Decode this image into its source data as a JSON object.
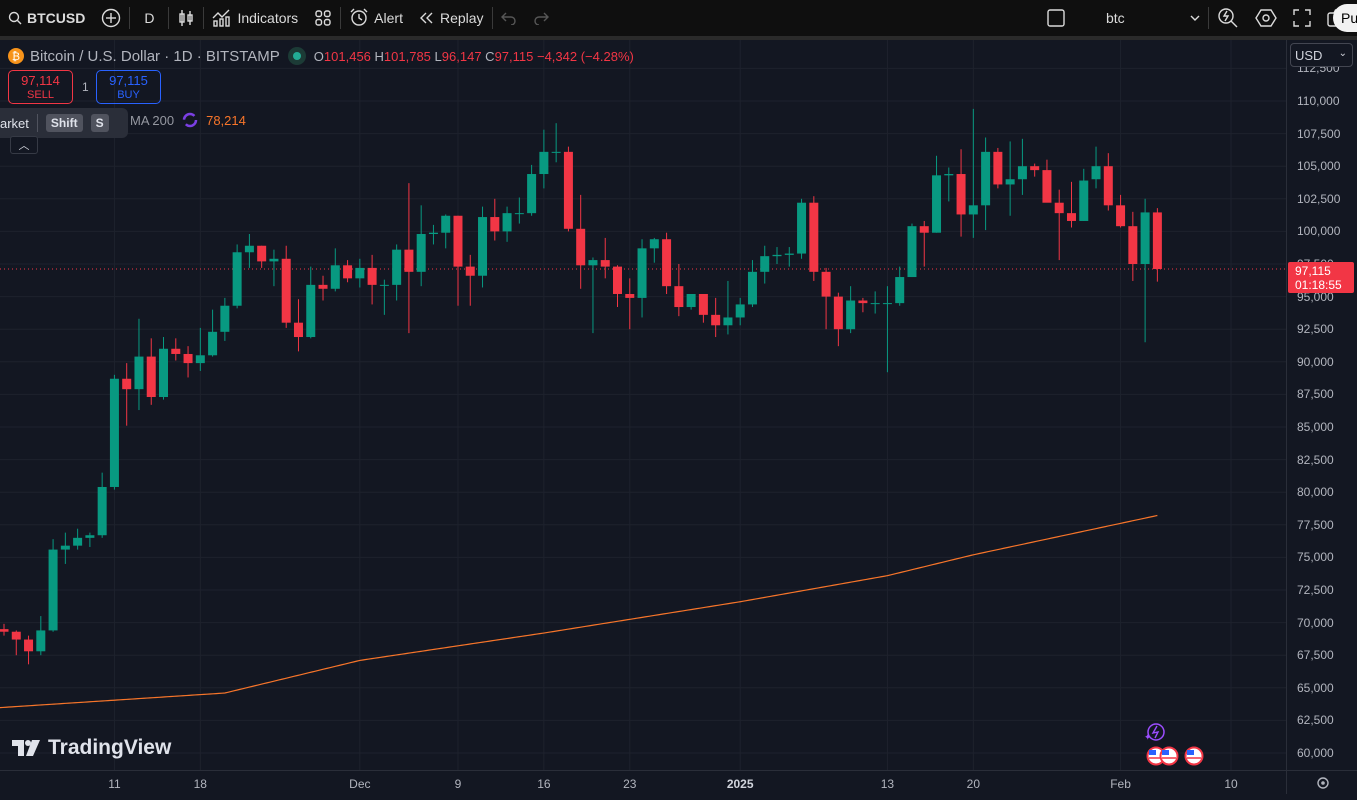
{
  "toolbar": {
    "symbol": "BTCUSD",
    "interval": "D",
    "indicators_label": "Indicators",
    "alert_label": "Alert",
    "replay_label": "Replay",
    "layout_name": "btc",
    "publish_label": "Pu"
  },
  "legend": {
    "title": "Bitcoin / U.S. Dollar · 1D · BITSTAMP",
    "o_label": "O",
    "o": "101,456",
    "h_label": "H",
    "h": "101,785",
    "l_label": "L",
    "l": "96,147",
    "c_label": "C",
    "c": "97,115",
    "change": "−4,342 (−4.28%)"
  },
  "trade": {
    "sell_price": "97,114",
    "sell_label": "SELL",
    "quantity": "1",
    "buy_price": "97,115",
    "buy_label": "BUY"
  },
  "tooltip": {
    "text": "arket",
    "key1": "Shift",
    "key2": "S"
  },
  "ma": {
    "label": "MA 200",
    "value": "78,214"
  },
  "currency": "USD",
  "price_tag": {
    "price": "97,115",
    "countdown": "01:18:55"
  },
  "brand": "TradingView",
  "colors": {
    "up": "#089981",
    "down": "#f23645",
    "ma": "#f7752a",
    "background": "#131722"
  },
  "chart_data": {
    "type": "candlestick",
    "symbol": "BTCUSD",
    "y_ticks": [
      "60,000",
      "62,500",
      "65,000",
      "67,500",
      "70,000",
      "72,500",
      "75,000",
      "77,500",
      "80,000",
      "82,500",
      "85,000",
      "87,500",
      "90,000",
      "92,500",
      "95,000",
      "97,500",
      "100,000",
      "102,500",
      "105,000",
      "107,500",
      "110,000",
      "112,500"
    ],
    "ylim": [
      60000,
      112500
    ],
    "x_ticks": [
      {
        "label": "11",
        "date": "2024-11-11"
      },
      {
        "label": "18",
        "date": "2024-11-18"
      },
      {
        "label": "Dec",
        "date": "2024-12-01"
      },
      {
        "label": "9",
        "date": "2024-12-09"
      },
      {
        "label": "16",
        "date": "2024-12-16"
      },
      {
        "label": "23",
        "date": "2024-12-23"
      },
      {
        "label": "2025",
        "date": "2025-01-01",
        "bold": true
      },
      {
        "label": "13",
        "date": "2025-01-13"
      },
      {
        "label": "20",
        "date": "2025-01-20"
      },
      {
        "label": "Feb",
        "date": "2025-02-01"
      },
      {
        "label": "10",
        "date": "2025-02-10"
      }
    ],
    "last_price": 97115,
    "candles_ohlc": [
      [
        "2024-11-02",
        69500,
        69900,
        69000,
        69300
      ],
      [
        "2024-11-03",
        69300,
        69400,
        67500,
        68700
      ],
      [
        "2024-11-04",
        68700,
        69000,
        66800,
        67800
      ],
      [
        "2024-11-05",
        67800,
        70500,
        67500,
        69400
      ],
      [
        "2024-11-06",
        69400,
        76400,
        69300,
        75600
      ],
      [
        "2024-11-07",
        75600,
        76900,
        74500,
        75900
      ],
      [
        "2024-11-08",
        75900,
        77200,
        75600,
        76500
      ],
      [
        "2024-11-09",
        76500,
        76900,
        75800,
        76700
      ],
      [
        "2024-11-10",
        76700,
        81500,
        76500,
        80400
      ],
      [
        "2024-11-11",
        80400,
        89000,
        80200,
        88700
      ],
      [
        "2024-11-12",
        88700,
        89900,
        85100,
        87900
      ],
      [
        "2024-11-13",
        87900,
        93300,
        86300,
        90400
      ],
      [
        "2024-11-14",
        90400,
        91800,
        86700,
        87300
      ],
      [
        "2024-11-15",
        87300,
        91900,
        87100,
        91000
      ],
      [
        "2024-11-16",
        91000,
        91800,
        90100,
        90600
      ],
      [
        "2024-11-17",
        90600,
        91200,
        88800,
        89900
      ],
      [
        "2024-11-18",
        89900,
        92600,
        89300,
        90500
      ],
      [
        "2024-11-19",
        90500,
        94000,
        90400,
        92300
      ],
      [
        "2024-11-20",
        92300,
        94900,
        91600,
        94300
      ],
      [
        "2024-11-21",
        94300,
        99000,
        94100,
        98400
      ],
      [
        "2024-11-22",
        98400,
        99800,
        97200,
        98900
      ],
      [
        "2024-11-23",
        98900,
        98900,
        97200,
        97700
      ],
      [
        "2024-11-24",
        97700,
        98600,
        95800,
        97900
      ],
      [
        "2024-11-25",
        97900,
        98900,
        92600,
        93000
      ],
      [
        "2024-11-26",
        93000,
        94800,
        90800,
        91900
      ],
      [
        "2024-11-27",
        91900,
        97300,
        91800,
        95900
      ],
      [
        "2024-11-28",
        95900,
        96600,
        94700,
        95600
      ],
      [
        "2024-11-29",
        95600,
        98700,
        95400,
        97400
      ],
      [
        "2024-11-30",
        97400,
        97800,
        96100,
        96400
      ],
      [
        "2024-12-01",
        96400,
        97900,
        95700,
        97200
      ],
      [
        "2024-12-02",
        97200,
        98200,
        94400,
        95900
      ],
      [
        "2024-12-03",
        95900,
        96300,
        93600,
        95900
      ],
      [
        "2024-12-04",
        95900,
        99000,
        94700,
        98600
      ],
      [
        "2024-12-05",
        98600,
        103700,
        92200,
        96900
      ],
      [
        "2024-12-06",
        96900,
        102000,
        95800,
        99800
      ],
      [
        "2024-12-07",
        99800,
        100500,
        99000,
        99900
      ],
      [
        "2024-12-08",
        99900,
        101300,
        98700,
        101200
      ],
      [
        "2024-12-09",
        101200,
        101200,
        94300,
        97300
      ],
      [
        "2024-12-10",
        97300,
        98200,
        94300,
        96600
      ],
      [
        "2024-12-11",
        96600,
        101900,
        95700,
        101100
      ],
      [
        "2024-12-12",
        101100,
        102500,
        99300,
        100000
      ],
      [
        "2024-12-13",
        100000,
        101900,
        99200,
        101400
      ],
      [
        "2024-12-14",
        101400,
        102600,
        100600,
        101400
      ],
      [
        "2024-12-15",
        101400,
        105100,
        101200,
        104400
      ],
      [
        "2024-12-16",
        104400,
        107800,
        103300,
        106100
      ],
      [
        "2024-12-17",
        106100,
        108300,
        105300,
        106100
      ],
      [
        "2024-12-18",
        106100,
        106500,
        100000,
        100200
      ],
      [
        "2024-12-19",
        100200,
        102800,
        95600,
        97400
      ],
      [
        "2024-12-20",
        97400,
        98000,
        92200,
        97800
      ],
      [
        "2024-12-21",
        97800,
        99500,
        96400,
        97300
      ],
      [
        "2024-12-22",
        97300,
        97400,
        94200,
        95200
      ],
      [
        "2024-12-23",
        95200,
        96400,
        92500,
        94900
      ],
      [
        "2024-12-24",
        94900,
        99400,
        93400,
        98700
      ],
      [
        "2024-12-25",
        98700,
        99500,
        97600,
        99400
      ],
      [
        "2024-12-26",
        99400,
        99900,
        95200,
        95800
      ],
      [
        "2024-12-27",
        95800,
        97500,
        93500,
        94200
      ],
      [
        "2024-12-28",
        94200,
        95200,
        94000,
        95200
      ],
      [
        "2024-12-29",
        95200,
        95200,
        93000,
        93600
      ],
      [
        "2024-12-30",
        93600,
        94900,
        91900,
        92800
      ],
      [
        "2024-12-31",
        92800,
        96200,
        92100,
        93400
      ],
      [
        "2025-01-01",
        93400,
        94900,
        92800,
        94400
      ],
      [
        "2025-01-02",
        94400,
        97800,
        94200,
        96900
      ],
      [
        "2025-01-03",
        96900,
        98900,
        96000,
        98100
      ],
      [
        "2025-01-04",
        98100,
        98800,
        97500,
        98200
      ],
      [
        "2025-01-05",
        98200,
        98800,
        97300,
        98300
      ],
      [
        "2025-01-06",
        98300,
        102500,
        97900,
        102200
      ],
      [
        "2025-01-07",
        102200,
        102700,
        96200,
        96900
      ],
      [
        "2025-01-08",
        96900,
        97200,
        92500,
        95000
      ],
      [
        "2025-01-09",
        95000,
        95300,
        91200,
        92500
      ],
      [
        "2025-01-10",
        92500,
        95800,
        92200,
        94700
      ],
      [
        "2025-01-11",
        94700,
        94900,
        93800,
        94500
      ],
      [
        "2025-01-12",
        94500,
        95400,
        93700,
        94500
      ],
      [
        "2025-01-13",
        94500,
        95800,
        89200,
        94500
      ],
      [
        "2025-01-14",
        94500,
        97300,
        94300,
        96500
      ],
      [
        "2025-01-15",
        96500,
        100600,
        96500,
        100400
      ],
      [
        "2025-01-16",
        100400,
        100800,
        97300,
        99900
      ],
      [
        "2025-01-17",
        99900,
        105800,
        99900,
        104300
      ],
      [
        "2025-01-18",
        104300,
        104900,
        102300,
        104400
      ],
      [
        "2025-01-19",
        104400,
        106300,
        99600,
        101300
      ],
      [
        "2025-01-20",
        101300,
        109400,
        99500,
        102000
      ],
      [
        "2025-01-21",
        102000,
        107200,
        100100,
        106100
      ],
      [
        "2025-01-22",
        106100,
        106400,
        103300,
        103600
      ],
      [
        "2025-01-23",
        103600,
        106900,
        101200,
        104000
      ],
      [
        "2025-01-24",
        104000,
        107100,
        102800,
        105000
      ],
      [
        "2025-01-25",
        105000,
        105200,
        104200,
        104700
      ],
      [
        "2025-01-26",
        104700,
        105500,
        102500,
        102200
      ],
      [
        "2025-01-27",
        102200,
        103200,
        97800,
        101400
      ],
      [
        "2025-01-28",
        101400,
        103800,
        100300,
        100800
      ],
      [
        "2025-01-29",
        100800,
        104800,
        100800,
        103900
      ],
      [
        "2025-01-30",
        104000,
        106500,
        103300,
        105000
      ],
      [
        "2025-01-31",
        105000,
        106000,
        101600,
        102000
      ],
      [
        "2025-02-01",
        102000,
        102800,
        100300,
        100400
      ],
      [
        "2025-02-02",
        100400,
        101500,
        96200,
        97500
      ],
      [
        "2025-02-03",
        97500,
        102500,
        91500,
        101456
      ],
      [
        "2025-02-04",
        101456,
        101785,
        96147,
        97115
      ]
    ],
    "ma200": {
      "name": "MA 200",
      "points": [
        [
          "2024-11-02",
          63500
        ],
        [
          "2024-11-20",
          64600
        ],
        [
          "2024-12-01",
          67100
        ],
        [
          "2024-12-16",
          69200
        ],
        [
          "2025-01-01",
          71600
        ],
        [
          "2025-01-13",
          73600
        ],
        [
          "2025-01-20",
          75200
        ],
        [
          "2025-02-04",
          78214
        ]
      ]
    }
  }
}
